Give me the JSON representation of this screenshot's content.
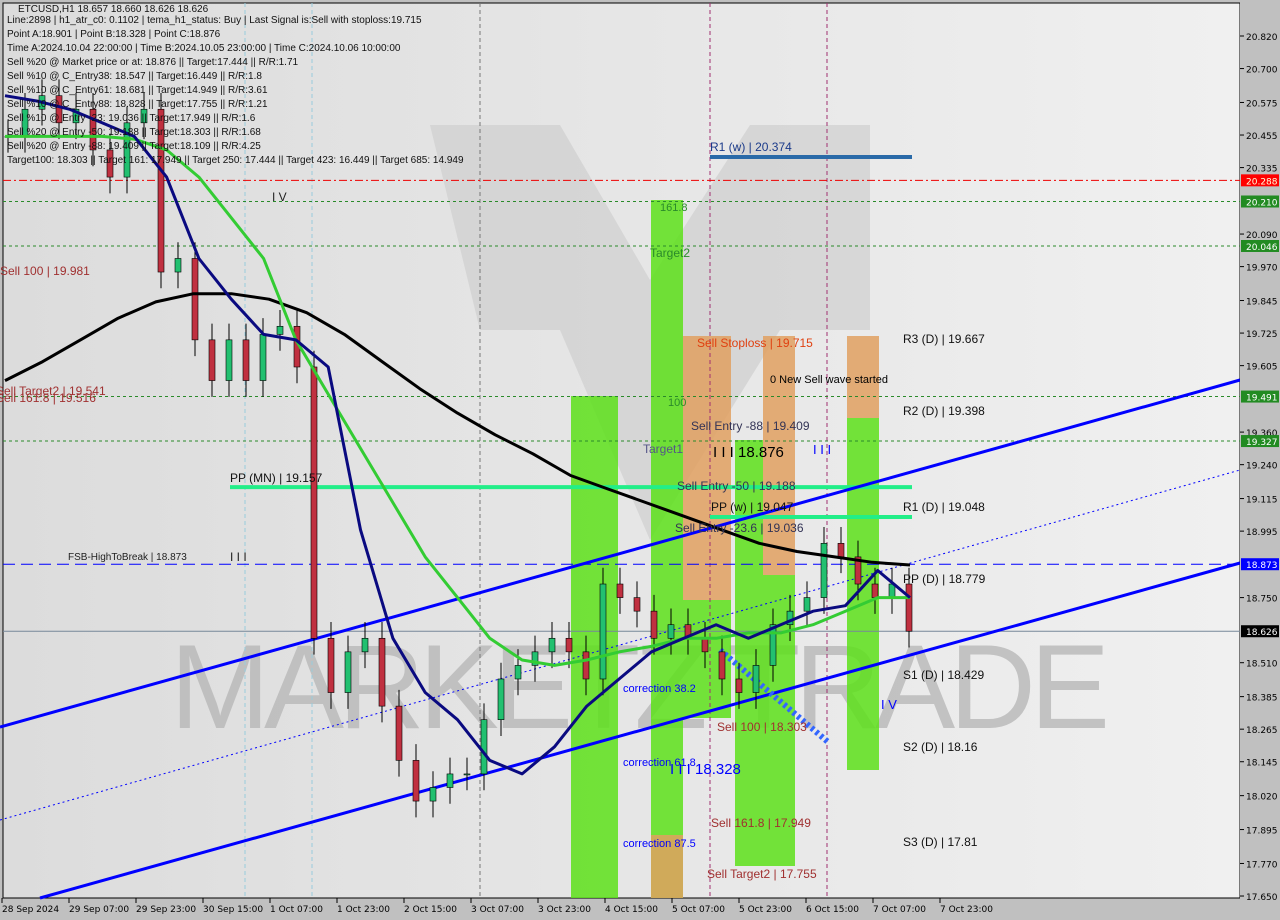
{
  "header": {
    "title": "ETCUSD,H1  18.657 18.660 18.626 18.626",
    "lines": [
      "Line:2898 | h1_atr_c0: 0.1102 | tema_h1_status: Buy | Last Signal is:Sell with stoploss:19.715",
      "Point A:18.901 | Point B:18.328 | Point C:18.876",
      "Time A:2024.10.04 22:00:00 | Time B:2024.10.05 23:00:00 | Time C:2024.10.06 10:00:00",
      "Sell %20 @ Market price or at: 18.876 || Target:17.444 || R/R:1.71",
      "Sell %10 @ C_Entry38: 18.547 || Target:16.449 || R/R:1.8",
      "Sell %10 @ C_Entry61: 18.681 || Target:14.949 || R/R:3.61",
      "Sell %10 @ C_Entry88: 18.828 || Target:17.755 || R/R:1.21",
      "Sell %10 @ Entry -23: 19.036 || Target:17.949 || R/R:1.6",
      "Sell %20 @ Entry -50: 19.188 || Target:18.303 || R/R:1.68",
      "Sell %20 @ Entry -88: 19.409 || Target:18.109 || R/R:4.25",
      "Target100: 18.303 || Target 161: 17.949 || Target 250: 17.444 || Target 423: 16.449 || Target 685: 14.949"
    ]
  },
  "watermark": "MARKETZ TRADE",
  "colors": {
    "bull": "#22c070",
    "bear": "#c03040",
    "ma_long": "#000000",
    "ma_fast": "#0a0a80",
    "ma_mid": "#33cc33",
    "green_zone": "#5de01a",
    "orange_zone": "#e0a060",
    "price_tag": "#000000",
    "red_tag": "#ff0000",
    "green_tag": "#228b22",
    "blue_tag": "#0000ff"
  },
  "chart_data": {
    "type": "candlestick",
    "symbol": "ETCUSD",
    "timeframe": "H1",
    "ylim": [
      17.65,
      20.82
    ],
    "y_ticks": [
      "20.820",
      "20.700",
      "20.575",
      "20.455",
      "20.335",
      "20.090",
      "19.970",
      "19.845",
      "19.725",
      "19.605",
      "19.360",
      "19.240",
      "19.115",
      "18.995",
      "18.750",
      "18.510",
      "18.385",
      "18.265",
      "18.145",
      "18.020",
      "17.895",
      "17.770",
      "17.650"
    ],
    "x_ticks": [
      "28 Sep 2024",
      "29 Sep 07:00",
      "29 Sep 23:00",
      "30 Sep 15:00",
      "1 Oct 07:00",
      "1 Oct 23:00",
      "2 Oct 15:00",
      "3 Oct 07:00",
      "3 Oct 23:00",
      "4 Oct 15:00",
      "5 Oct 07:00",
      "5 Oct 23:00",
      "6 Oct 15:00",
      "7 Oct 07:00",
      "7 Oct 23:00"
    ],
    "close": [
      20.45,
      20.55,
      20.6,
      20.5,
      20.55,
      20.4,
      20.3,
      20.5,
      20.55,
      19.95,
      20.0,
      19.7,
      19.55,
      19.7,
      19.55,
      19.72,
      19.75,
      19.6,
      18.6,
      18.4,
      18.55,
      18.6,
      18.35,
      18.15,
      18.0,
      18.05,
      18.1,
      18.1,
      18.3,
      18.45,
      18.5,
      18.55,
      18.6,
      18.55,
      18.45,
      18.8,
      18.75,
      18.7,
      18.6,
      18.65,
      18.6,
      18.55,
      18.45,
      18.4,
      18.5,
      18.65,
      18.7,
      18.75,
      18.95,
      18.9,
      18.8,
      18.75,
      18.8,
      18.626
    ],
    "ma_long": [
      19.55,
      19.62,
      19.7,
      19.78,
      19.84,
      19.87,
      19.87,
      19.85,
      19.8,
      19.72,
      19.62,
      19.52,
      19.43,
      19.35,
      19.28,
      19.2,
      19.15,
      19.1,
      19.05,
      19.0,
      18.95,
      18.92,
      18.9,
      18.88,
      18.87
    ],
    "ma_fast": [
      20.6,
      20.58,
      20.55,
      20.5,
      20.45,
      20.3,
      20.0,
      19.85,
      19.72,
      19.7,
      19.6,
      19.0,
      18.6,
      18.4,
      18.3,
      18.15,
      18.1,
      18.2,
      18.35,
      18.45,
      18.55,
      18.6,
      18.65,
      18.6,
      18.65,
      18.7,
      18.72,
      18.85,
      18.75
    ],
    "ma_mid": [
      20.45,
      20.45,
      20.45,
      20.45,
      20.44,
      20.4,
      20.3,
      20.15,
      20.0,
      19.7,
      19.5,
      19.3,
      19.1,
      18.9,
      18.75,
      18.6,
      18.52,
      18.5,
      18.52,
      18.55,
      18.57,
      18.6,
      18.6,
      18.62,
      18.62,
      18.65,
      18.7,
      18.75,
      18.75
    ],
    "price_tags": [
      {
        "value": "20.288",
        "kind": "red"
      },
      {
        "value": "20.210",
        "kind": "green"
      },
      {
        "value": "20.046",
        "kind": "green"
      },
      {
        "value": "19.491",
        "kind": "green"
      },
      {
        "value": "19.327",
        "kind": "green"
      },
      {
        "value": "18.873",
        "kind": "blue"
      },
      {
        "value": "18.626",
        "kind": "price"
      }
    ],
    "levels": {
      "r1w": "R1 (w) | 20.374",
      "ppmn": "PP (MN) | 19.157",
      "ppw": "PP (w) | 19.047",
      "r3d": "R3 (D) | 19.667",
      "r2d": "R2 (D) | 19.398",
      "r1d": "R1 (D) | 19.048",
      "ppd": "PP (D) | 18.779",
      "s1d": "S1 (D) | 18.429",
      "s2d": "S2 (D) | 18.16",
      "s3d": "S3 (D) | 17.81"
    },
    "annotations": {
      "sell100_left": "Sell 100 | 19.981",
      "sell_target2_left": "Sell Target2 | 19.541",
      "sell1618_left": "Sell 161.8 | 19.516",
      "fsb": "FSB-HighToBreak | 18.873",
      "iv_left": "I V",
      "iii_left": "I I I",
      "f1618": "161.8",
      "target2": "Target2",
      "f100": "100",
      "target1": "Target1",
      "sell_stoploss": "Sell Stoploss | 19.715",
      "new_wave": "0 New Sell wave started",
      "sell_entry_88": "Sell Entry -88 | 19.409",
      "point_c": "I I I 18.876",
      "iii_right": "I I I",
      "sell_entry_50": "Sell Entry -50 | 19.188",
      "sell_entry_236": "Sell Entry -23.6 | 19.036",
      "corr382": "correction 38.2",
      "corr618": "correction 61.8",
      "corr875": "correction 87.5",
      "point_b": "I I I 18.328",
      "sell100": "Sell 100 | 18.303",
      "sell1618": "Sell 161.8 | 17.949",
      "sell_target2": "Sell Target2 | 17.755",
      "iv_right": "I V"
    }
  }
}
